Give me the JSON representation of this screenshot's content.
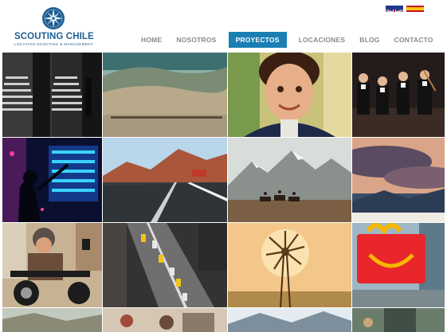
{
  "brand": {
    "name": "SCOUTING CHILE",
    "tagline": "LOCATION SCOUTING & MANAGEMENT",
    "color": "#1f5f93"
  },
  "languages": [
    {
      "code": "en",
      "icon": "uk-flag-icon"
    },
    {
      "code": "es",
      "icon": "spain-flag-icon"
    }
  ],
  "nav": {
    "items": [
      "HOME",
      "NOSOTROS",
      "PROYECTOS",
      "LOCACIONES",
      "BLOG",
      "CONTACTO"
    ],
    "active_index": 2,
    "active_color": "#1b7fb4"
  },
  "gallery": {
    "columns": 4,
    "tiles": [
      "staircase-mirror",
      "desert-valley",
      "smiling-boy",
      "orchestra",
      "neon-silhouette",
      "desert-highway",
      "mountain-riders",
      "cloudy-sunset",
      "motorcycle-rider",
      "city-traffic-aerial",
      "windmill-sunset",
      "happy-meal-box",
      "landscape-row",
      "street-crowd",
      "lake-mountains",
      "city-street"
    ]
  }
}
